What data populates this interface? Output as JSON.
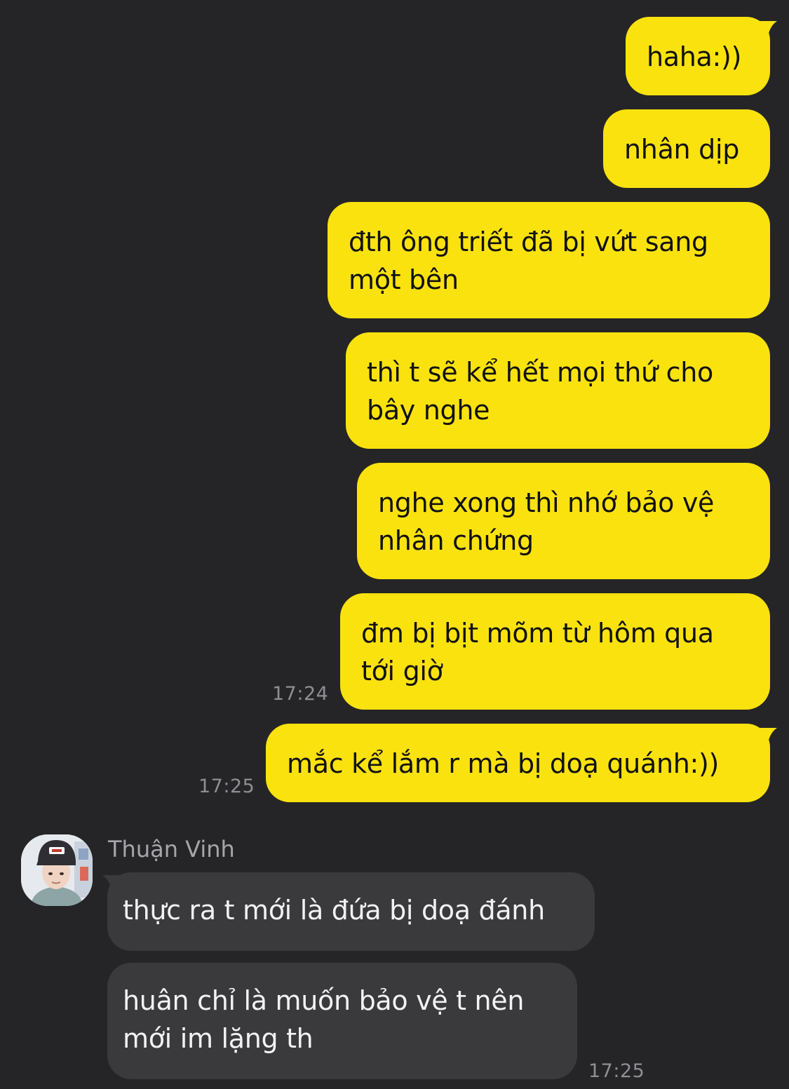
{
  "colors": {
    "background": "#252527",
    "outgoing_bubble": "#fae20f",
    "incoming_bubble": "#3a3a3c",
    "outgoing_text": "#111111",
    "incoming_text": "#f2f2f2",
    "timestamp": "#8e8e93"
  },
  "outgoing": [
    {
      "lines": [
        "haha:))"
      ]
    },
    {
      "lines": [
        "nhân dịp"
      ]
    },
    {
      "lines": [
        "đth ông triết đã bị vứt sang",
        "một bên"
      ]
    },
    {
      "lines": [
        "thì t sẽ kể hết mọi thứ cho",
        "bây nghe"
      ]
    },
    {
      "lines": [
        "nghe xong thì nhớ bảo vệ",
        "nhân chứng"
      ]
    },
    {
      "lines": [
        "đm bị bịt mõm từ hôm qua",
        "tới giờ"
      ],
      "time": "17:24"
    },
    {
      "lines": [
        "mắc kể lắm r mà bị doạ quánh:))"
      ],
      "time": "17:25"
    }
  ],
  "contact": {
    "name": "Thuận Vinh",
    "avatar_icon": "user-photo-avatar"
  },
  "incoming": [
    {
      "lines": [
        "thực ra t mới là đứa bị doạ đánh"
      ]
    },
    {
      "lines": [
        "huân chỉ là muốn bảo vệ t nên",
        "mới im lặng th"
      ],
      "time": "17:25"
    }
  ]
}
